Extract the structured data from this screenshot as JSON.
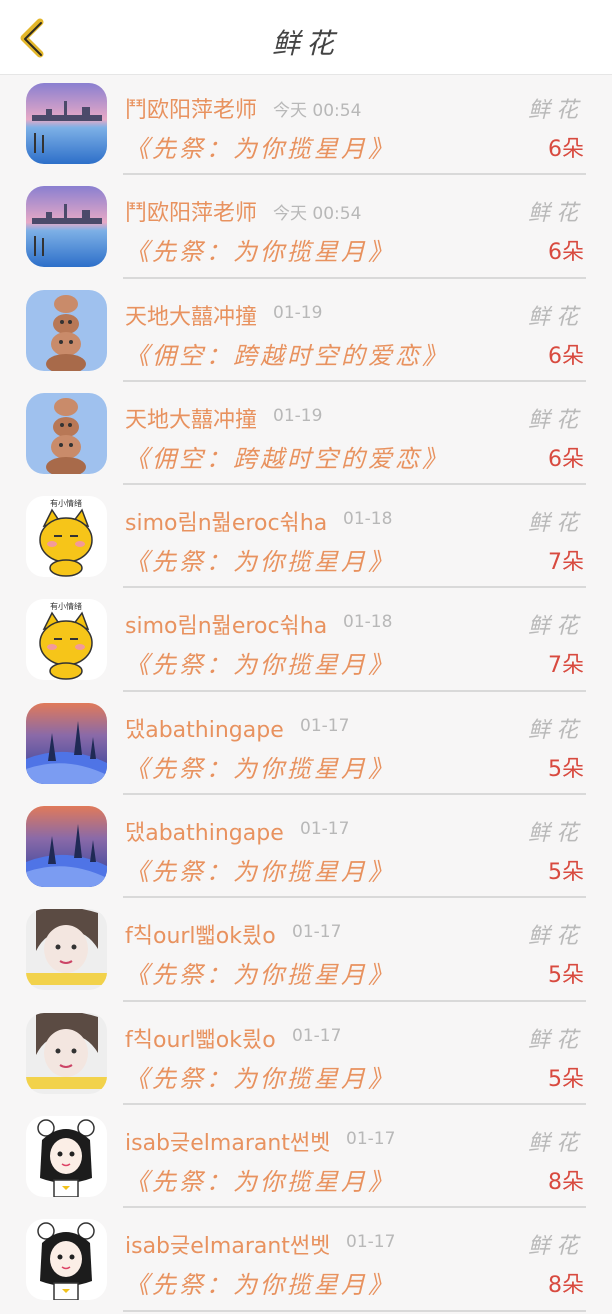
{
  "header": {
    "title": "鲜花"
  },
  "rows": [
    {
      "name": "鬥欧阳萍老师",
      "time": "今天 00:54",
      "gift": "《先祭：为你揽星月》",
      "label": "鲜花",
      "count": "6朵",
      "avatar": "venice"
    },
    {
      "name": "鬥欧阳萍老师",
      "time": "今天 00:54",
      "gift": "《先祭：为你揽星月》",
      "label": "鲜花",
      "count": "6朵",
      "avatar": "venice"
    },
    {
      "name": "天地大囍冲撞",
      "time": "01-19",
      "gift": "《佣空：跨越时空的爱恋》",
      "label": "鲜花",
      "count": "6朵",
      "avatar": "totem"
    },
    {
      "name": "天地大囍冲撞",
      "time": "01-19",
      "gift": "《佣空：跨越时空的爱恋》",
      "label": "鲜花",
      "count": "6朵",
      "avatar": "totem"
    },
    {
      "name": "simo림n뭚eroc쉮ha",
      "time": "01-18",
      "gift": "《先祭：为你揽星月》",
      "label": "鲜花",
      "count": "7朵",
      "avatar": "cat",
      "avatar_text": "有小情绪"
    },
    {
      "name": "simo림n뭚eroc쉮ha",
      "time": "01-18",
      "gift": "《先祭：为你揽星月》",
      "label": "鲜花",
      "count": "7朵",
      "avatar": "cat",
      "avatar_text": "有小情绪"
    },
    {
      "name": "댔abathingape",
      "time": "01-17",
      "gift": "《先祭：为你揽星月》",
      "label": "鲜花",
      "count": "5朵",
      "avatar": "snow"
    },
    {
      "name": "댔abathingape",
      "time": "01-17",
      "gift": "《先祭：为你揽星月》",
      "label": "鲜花",
      "count": "5朵",
      "avatar": "snow"
    },
    {
      "name": "f칙ourl뺇ok릤o",
      "time": "01-17",
      "gift": "《先祭：为你揽星月》",
      "label": "鲜花",
      "count": "5朵",
      "avatar": "girl"
    },
    {
      "name": "f칙ourl뺇ok릤o",
      "time": "01-17",
      "gift": "《先祭：为你揽星月》",
      "label": "鲜花",
      "count": "5朵",
      "avatar": "girl"
    },
    {
      "name": "isab긎elmarant썬벳",
      "time": "01-17",
      "gift": "《先祭：为你揽星月》",
      "label": "鲜花",
      "count": "8朵",
      "avatar": "bear"
    },
    {
      "name": "isab긎elmarant썬벳",
      "time": "01-17",
      "gift": "《先祭：为你揽星月》",
      "label": "鲜花",
      "count": "8朵",
      "avatar": "bear"
    }
  ],
  "colors": {
    "accent": "#e8925f",
    "count": "#d84a3f",
    "muted": "#b9b9b9",
    "back": "#e3b62a"
  },
  "icons": {
    "back": "back-arrow-icon"
  }
}
